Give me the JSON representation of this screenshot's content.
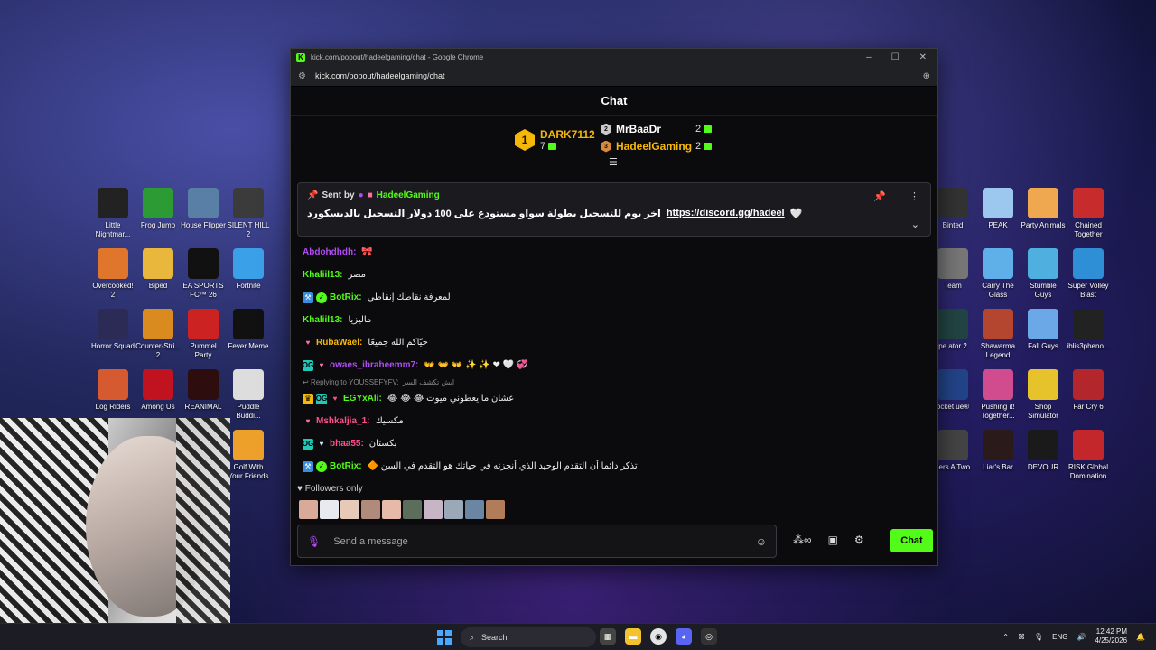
{
  "desktop": {
    "left_icons": [
      {
        "label": "Little Nightmar...",
        "color": "#222"
      },
      {
        "label": "Frog Jump",
        "color": "#2c9b34"
      },
      {
        "label": "House Flipper",
        "color": "#5a7fa6"
      },
      {
        "label": "SILENT HILL 2",
        "color": "#3b3b3b"
      },
      {
        "label": "Overcooked! 2",
        "color": "#e0762b"
      },
      {
        "label": "Biped",
        "color": "#e8b73b"
      },
      {
        "label": "EA SPORTS FC™ 26",
        "color": "#111"
      },
      {
        "label": "Fortnite",
        "color": "#3aa0e8"
      },
      {
        "label": "Horror Squad",
        "color": "#2b2b55"
      },
      {
        "label": "Counter-Stri... 2",
        "color": "#d98b1f"
      },
      {
        "label": "Pummel Party",
        "color": "#c22"
      },
      {
        "label": "Fever Meme",
        "color": "#111"
      },
      {
        "label": "Log Riders",
        "color": "#d55a2f"
      },
      {
        "label": "Among Us",
        "color": "#c1121f"
      },
      {
        "label": "REANIMAL",
        "color": "#2d0d0d"
      },
      {
        "label": "Puddle Buddi...",
        "color": "#ddd"
      },
      {
        "label": "Golf With Your Friends",
        "color": "#eea12a"
      }
    ],
    "right_icons": [
      {
        "label": "Binted",
        "color": "#333"
      },
      {
        "label": "PEAK",
        "color": "#9cc7ef"
      },
      {
        "label": "Party Animals",
        "color": "#f0a850"
      },
      {
        "label": "Chained Together",
        "color": "#c82b2b"
      },
      {
        "label": "Team",
        "color": "#777"
      },
      {
        "label": "Carry The Glass",
        "color": "#5fb0e8"
      },
      {
        "label": "Stumble Guys",
        "color": "#4fb0e0"
      },
      {
        "label": "Super Volley Blast",
        "color": "#2f8fd6"
      },
      {
        "label": "pe ator 2",
        "color": "#244"
      },
      {
        "label": "Shawarma Legend",
        "color": "#b4452f"
      },
      {
        "label": "Fall Guys",
        "color": "#6aa8e8"
      },
      {
        "label": "iblis3pheno...",
        "color": "#222"
      },
      {
        "label": "ocket ue®",
        "color": "#224488"
      },
      {
        "label": "Pushing it! Together...",
        "color": "#d14b8f"
      },
      {
        "label": "Shop Simulator",
        "color": "#e6c22b"
      },
      {
        "label": "Far Cry 6",
        "color": "#b3262b"
      },
      {
        "label": "llers A Two",
        "color": "#444"
      },
      {
        "label": "Liar's Bar",
        "color": "#2a1a1a"
      },
      {
        "label": "DEVOUR",
        "color": "#1a1a1a"
      },
      {
        "label": "RISK Global Domination",
        "color": "#c3262b"
      }
    ]
  },
  "window": {
    "title": "kick.com/popout/hadeelgaming/chat - Google Chrome",
    "favicon": "K",
    "url": "kick.com/popout/hadeelgaming/chat",
    "minimize": "–",
    "maximize": "☐",
    "close": "✕"
  },
  "chat": {
    "header": "Chat",
    "leaderboard": {
      "first": {
        "rank": "1",
        "name": "DARK7112",
        "count": "7"
      },
      "second": {
        "rank": "2",
        "name": "MrBaaDr",
        "count": "2"
      },
      "third": {
        "rank": "3",
        "name": "HadeelGaming",
        "count": "2"
      }
    },
    "pinned": {
      "sent_by": "Sent by",
      "sender": "HadeelGaming",
      "text": "اخر يوم للتسجيل بطولة سواو مستودع على 100 دولار التسجيل بالديسكورد",
      "link": "https://discord.gg/hadeel"
    },
    "messages": [
      {
        "user": "Abdohdhdh:",
        "text": "🎀",
        "color": "#b04cf2"
      },
      {
        "user": "Khaliil13:",
        "text": "مصر",
        "color": "#53fc18"
      },
      {
        "user": "BotRix:",
        "text": "لمعرفة نقاطك إنقاطي",
        "color": "#53fc18"
      },
      {
        "user": "Khaliil13:",
        "text": "ماليزيا",
        "color": "#53fc18"
      },
      {
        "user": "RubaWael:",
        "text": "حيّاكم الله جميعًا",
        "color": "#f5b70a"
      },
      {
        "user": "owaes_ibraheemm7:",
        "text": "👐 👐 👐 ✨ ✨ ❤ 🤍 💞",
        "color": "#b04cf2"
      },
      {
        "user": "EGYxAli:",
        "text": "عشان ما يعطوني ميوت 😂 😂 😂",
        "color": "#53fc18"
      },
      {
        "user": "Mshkaljia_1:",
        "text": "مكسيك",
        "color": "#ff4f8a"
      },
      {
        "user": "bhaa55:",
        "text": "بكستان",
        "color": "#ff4f8a"
      },
      {
        "user": "BotRix:",
        "text": "تذكر دائما أن التقدم الوحيد الذي أنجزته في حياتك هو التقدم في السن 🔶",
        "color": "#53fc18"
      }
    ],
    "reply": {
      "label": "Replying to YOUSSEFYFV:",
      "snippet": "ايش تكشف السر"
    },
    "followers_only": "Followers only",
    "input_placeholder": "Send a message",
    "chat_button": "Chat"
  },
  "taskbar": {
    "search": "Search",
    "language": "ENG",
    "time": "12:42 PM",
    "date": "4/25/2026"
  }
}
